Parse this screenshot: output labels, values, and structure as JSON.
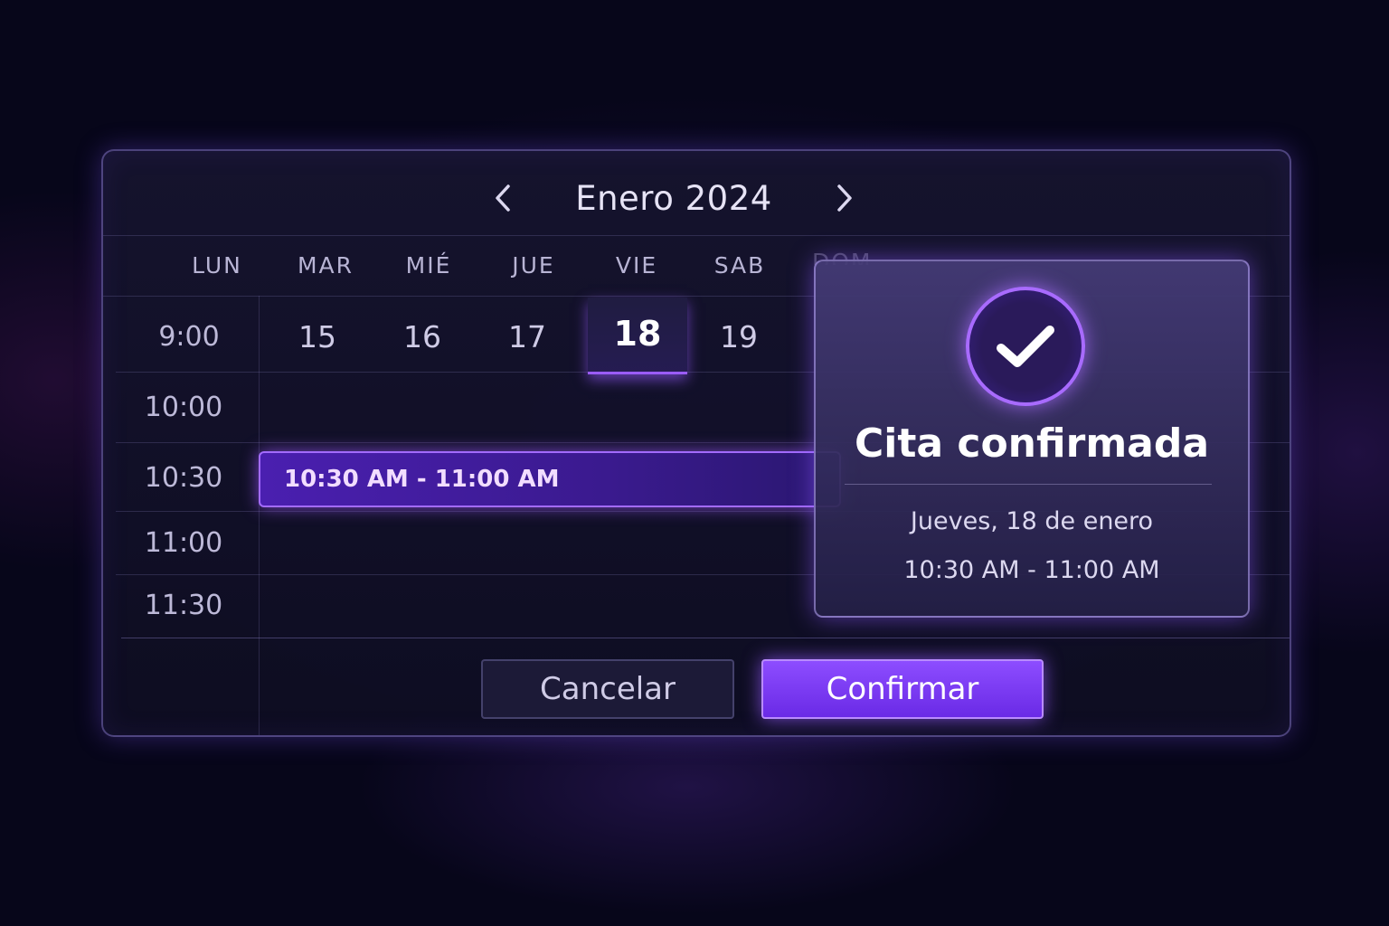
{
  "calendar": {
    "month_title": "Enero 2024",
    "prev_icon": "chevron-left-icon",
    "next_icon": "chevron-right-icon",
    "weekdays": [
      "LUN",
      "MAR",
      "MIÉ",
      "JUE",
      "VIE",
      "SAB",
      "DOM"
    ],
    "days": [
      "15",
      "16",
      "17",
      "18",
      "19"
    ],
    "selected_day": "18",
    "times": [
      "9:00",
      "10:00",
      "10:30",
      "11:00",
      "11:30"
    ],
    "event_label": "10:30 AM - 11:00 AM",
    "accent_color": "#8d4dff"
  },
  "actions": {
    "cancel_label": "Cancelar",
    "confirm_label": "Confirmar"
  },
  "confirmation": {
    "icon": "check-circle-icon",
    "title": "Cita confirmada",
    "date": "Jueves, 18 de enero",
    "time": "10:30 AM - 11:00 AM"
  }
}
